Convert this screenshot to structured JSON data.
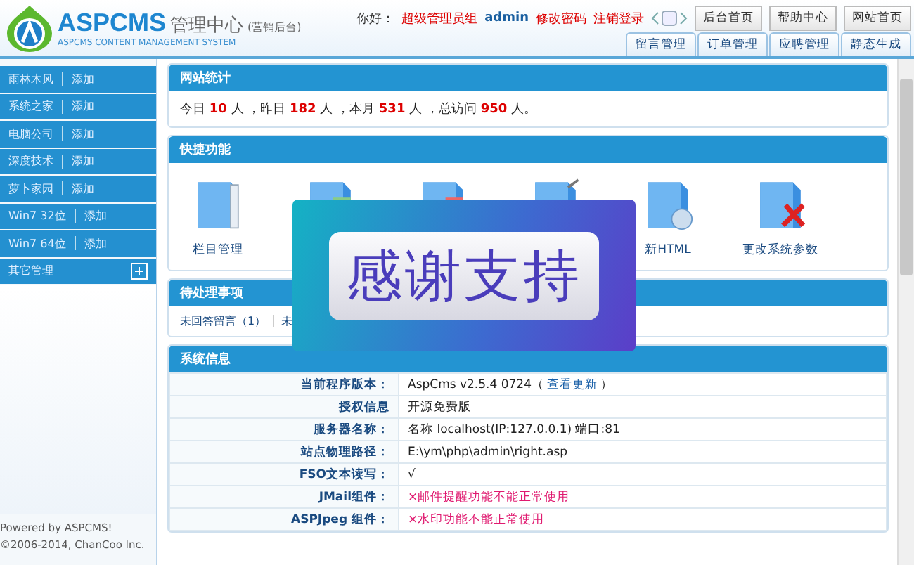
{
  "header": {
    "logo_name": "ASPCMS",
    "logo_title": "管理中心",
    "logo_suffix": "(营销后台)",
    "logo_subtitle": "ASPCMS CONTENT MANAGEMENT SYSTEM",
    "greeting": "你好：",
    "role": "超级管理员组",
    "user": "admin",
    "links": [
      "修改密码",
      "注销登录"
    ],
    "top_buttons": [
      "后台首页",
      "帮助中心",
      "网站首页"
    ],
    "tabs": [
      "留言管理",
      "订单管理",
      "应聘管理",
      "静态生成"
    ]
  },
  "sidebar": {
    "items": [
      {
        "label": "雨林木风",
        "action": "添加"
      },
      {
        "label": "系统之家",
        "action": "添加"
      },
      {
        "label": "电脑公司",
        "action": "添加"
      },
      {
        "label": "深度技术",
        "action": "添加"
      },
      {
        "label": "萝卜家园",
        "action": "添加"
      },
      {
        "label": "Win7 32位",
        "action": "添加"
      },
      {
        "label": "Win7 64位",
        "action": "添加"
      }
    ],
    "group": {
      "label": "其它管理",
      "expanded": false
    },
    "footer": [
      "Powered by ASPCMS!",
      "©2006-2014, ChanCoo Inc."
    ]
  },
  "stats": {
    "title": "网站统计",
    "parts": [
      {
        "label": "今日",
        "count": "10",
        "unit": "人 ，"
      },
      {
        "label": "昨日",
        "count": "182",
        "unit": "人 ，"
      },
      {
        "label": "本月",
        "count": "531",
        "unit": "人 ，"
      },
      {
        "label": "总访问",
        "count": "950",
        "unit": "人。"
      }
    ]
  },
  "shortcuts": {
    "title": "快捷功能",
    "items": [
      {
        "label": "栏目管理",
        "kind": "book"
      },
      {
        "kind": "list"
      },
      {
        "kind": "red"
      },
      {
        "kind": "pen"
      },
      {
        "label": "新HTML",
        "kind": "globe"
      },
      {
        "label": "更改系统参数",
        "kind": "tools"
      }
    ]
  },
  "pending": {
    "title": "待处理事项",
    "items": [
      "未回答留言（1）",
      "未"
    ]
  },
  "banner": {
    "text": "感谢支持"
  },
  "sysinfo": {
    "title": "系统信息",
    "rows": [
      {
        "label": "当前程序版本：",
        "value": "AspCms v2.5.4 0724（",
        "link": "查看更新",
        "value_end": "）",
        "kind": "normal"
      },
      {
        "label": "授权信息",
        "value": "开源免费版",
        "kind": "normal"
      },
      {
        "label": "服务器名称：",
        "value": "名称 localhost(IP:127.0.0.1) 端口:81",
        "kind": "normal"
      },
      {
        "label": "站点物理路径：",
        "value": "E:\\ym\\php\\admin\\right.asp",
        "kind": "normal"
      },
      {
        "label": "FSO文本读写：",
        "value": "√",
        "kind": "normal"
      },
      {
        "label": "JMail组件：",
        "value": "×邮件提醒功能不能正常使用",
        "kind": "warning"
      },
      {
        "label": "ASPJpeg 组件：",
        "value": "×水印功能不能正常使用",
        "kind": "warning"
      }
    ]
  }
}
